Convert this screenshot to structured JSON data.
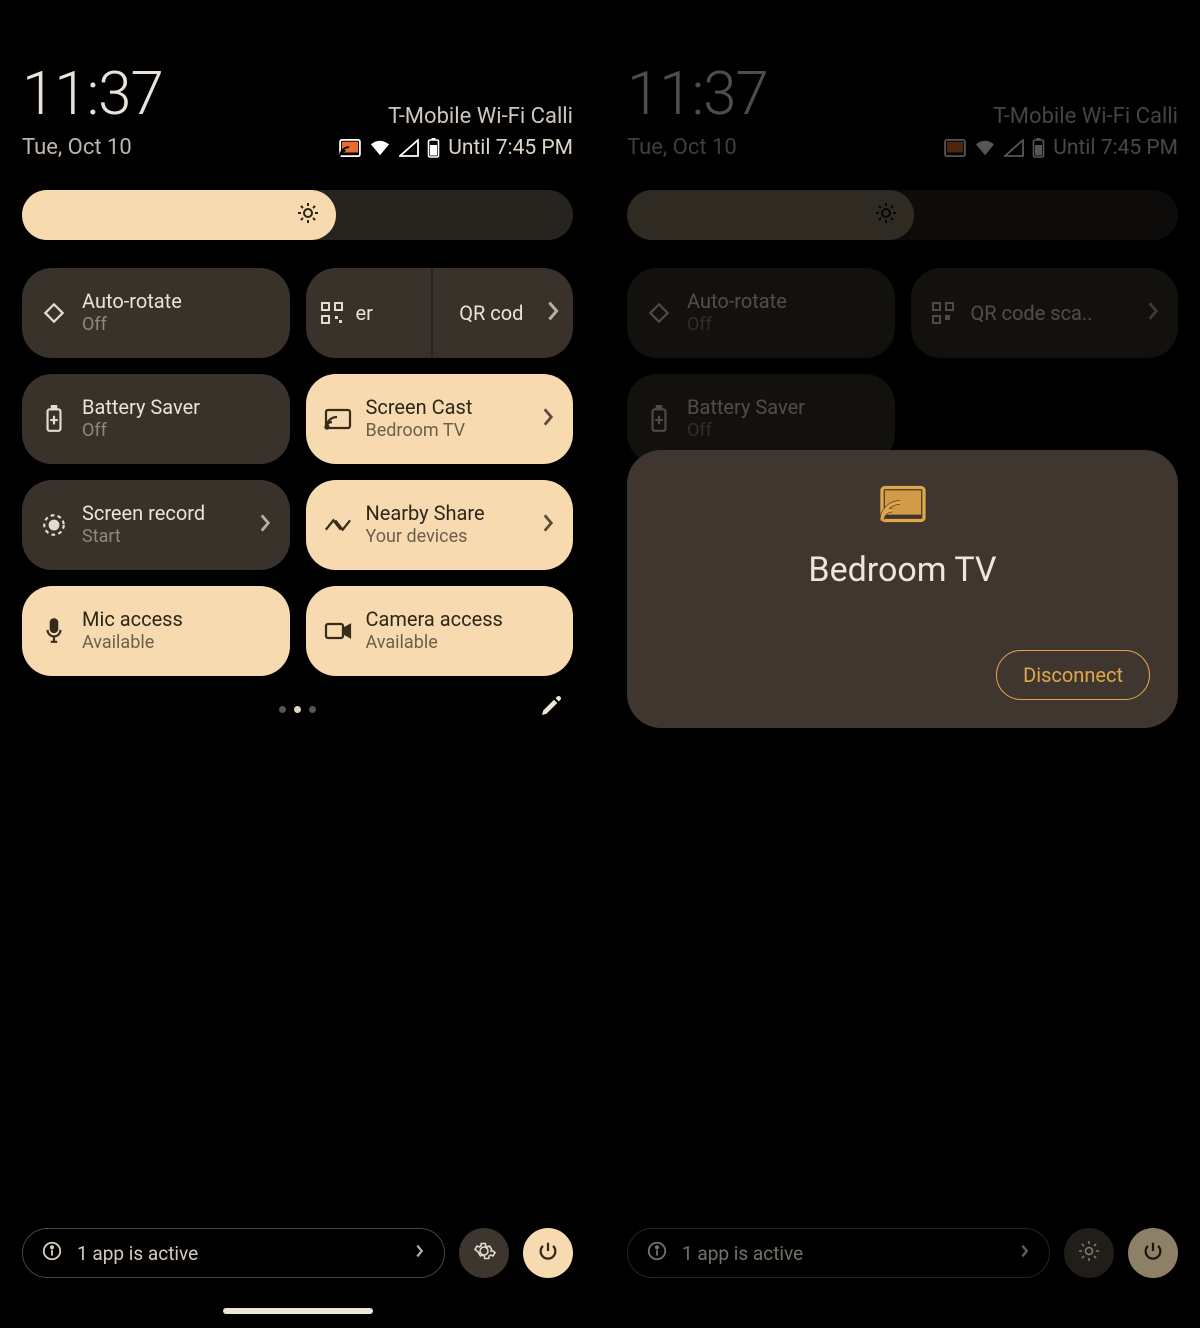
{
  "left": {
    "status": {
      "time": "11:37",
      "carrier": "T-Mobile Wi-Fi Calli",
      "date": "Tue, Oct 10",
      "until": "Until 7:45 PM"
    },
    "tiles": {
      "autorotate": {
        "label": "Auto-rotate",
        "sub": "Off"
      },
      "qr": {
        "partA": "er",
        "partB": "QR cod"
      },
      "battery": {
        "label": "Battery Saver",
        "sub": "Off"
      },
      "cast": {
        "label": "Screen Cast",
        "sub": "Bedroom TV"
      },
      "record": {
        "label": "Screen record",
        "sub": "Start"
      },
      "nearby": {
        "label": "Nearby Share",
        "sub": "Your devices"
      },
      "mic": {
        "label": "Mic access",
        "sub": "Available"
      },
      "camera": {
        "label": "Camera access",
        "sub": "Available"
      }
    },
    "footer": {
      "active": "1 app is active"
    }
  },
  "right": {
    "status": {
      "time": "11:37",
      "carrier": "T-Mobile Wi-Fi Calli",
      "date": "Tue, Oct 10",
      "until": "Until 7:45 PM"
    },
    "tiles": {
      "autorotate": {
        "label": "Auto-rotate",
        "sub": "Off"
      },
      "qr": {
        "label": "QR code sca.."
      },
      "battery": {
        "label": "Battery Saver",
        "sub": "Off"
      }
    },
    "cast": {
      "device": "Bedroom TV",
      "button": "Disconnect"
    },
    "footer": {
      "active": "1 app is active"
    }
  }
}
